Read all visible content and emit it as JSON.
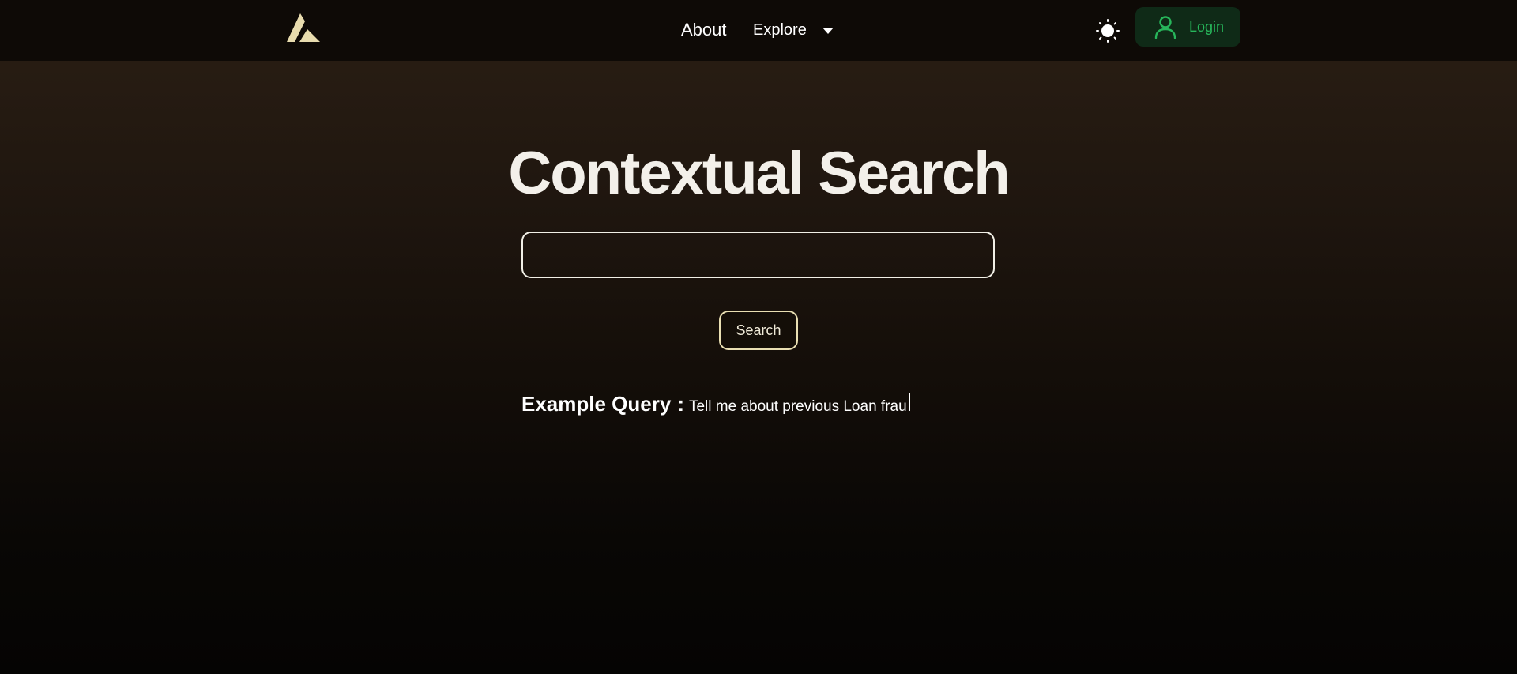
{
  "nav": {
    "about": "About",
    "explore": "Explore",
    "login": "Login"
  },
  "hero": {
    "title": "Contextual Search"
  },
  "search": {
    "value": "",
    "button_label": "Search"
  },
  "example": {
    "label": "Example Query",
    "separator": ":",
    "text": "Tell me about previous Loan frau"
  },
  "icons": {
    "logo": "logo-icon",
    "explore_caret": "chevron-down-icon",
    "theme": "sun-icon",
    "login": "user-icon"
  },
  "colors": {
    "navbar": "#0e0a06",
    "login_bg": "#0f2a17",
    "login_text": "#27b65b",
    "search_button_border": "#e9dfb3",
    "title": "#f3f0ea",
    "logo": "#e8dcae"
  }
}
